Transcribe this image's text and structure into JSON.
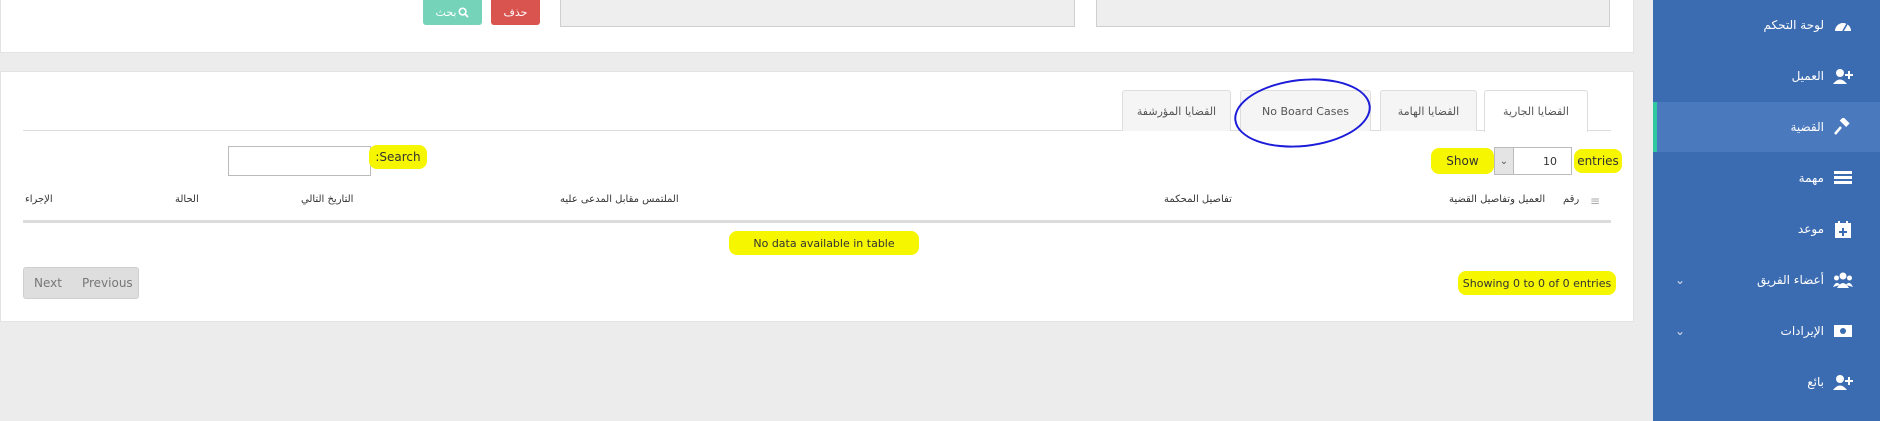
{
  "top_panel": {
    "delete_label": "حذف",
    "search_label": "بحث"
  },
  "tabs": [
    {
      "label": "القضايا الجارية",
      "active": true
    },
    {
      "label": "القضايا الهامة",
      "active": false
    },
    {
      "label": "No Board Cases",
      "active": false
    },
    {
      "label": "القضايا المؤرشفة",
      "active": false
    }
  ],
  "table_controls": {
    "show_label": "Show",
    "page_length": "10",
    "entries_label": "entries",
    "search_label": ":Search",
    "search_value": ""
  },
  "table": {
    "columns": [
      "رقم",
      "العميل وتفاصيل القضية",
      "تفاصيل المحكمة",
      "الملتمس مقابل المدعى عليه",
      "التاريخ التالي",
      "الحالة",
      "الإجراء"
    ],
    "empty_message": "No data available in table",
    "info": "Showing 0 to 0 of 0 entries"
  },
  "pagination": {
    "previous_label": "Previous",
    "next_label": "Next"
  },
  "sidebar": {
    "items": [
      {
        "label": "لوحة التحكم",
        "icon": "dashboard-icon"
      },
      {
        "label": "العميل",
        "icon": "add-user-icon"
      },
      {
        "label": "القضية",
        "icon": "gavel-icon"
      },
      {
        "label": "مهمة",
        "icon": "tasks-icon"
      },
      {
        "label": "موعد",
        "icon": "calendar-plus-icon"
      },
      {
        "label": "أعضاء الفريق",
        "icon": "team-icon"
      },
      {
        "label": "الإيرادات",
        "icon": "money-icon"
      },
      {
        "label": "بائع",
        "icon": "add-vendor-icon"
      }
    ]
  },
  "colors": {
    "sidebar_bg": "#3b6bb1",
    "active_accent": "#2fc8a0",
    "delete_button": "#d9534f",
    "search_button": "#74d3b8",
    "highlight": "#f6f600",
    "annotation_circle": "#1c1cd9"
  }
}
